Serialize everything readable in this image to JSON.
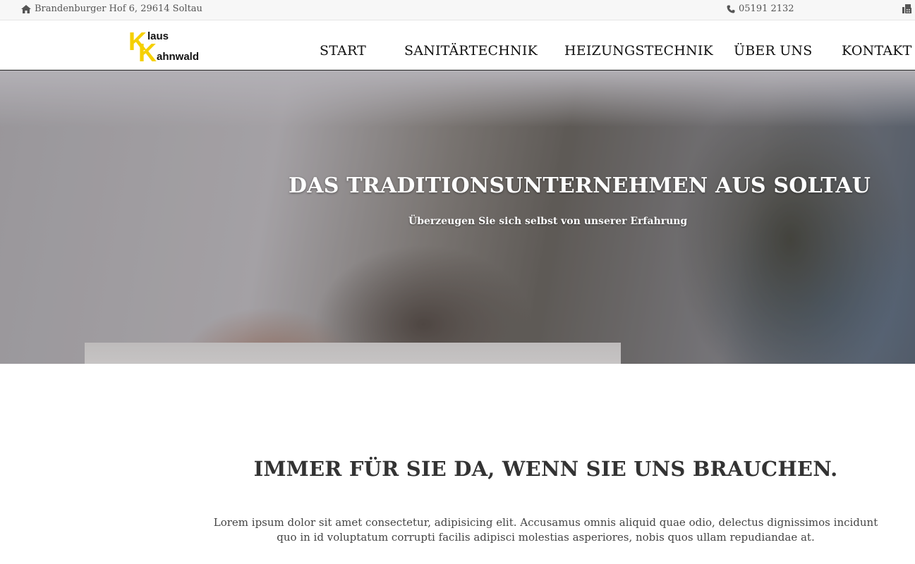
{
  "topbar": {
    "address": "Brandenburger Hof 6, 29614 Soltau",
    "phone": "05191 2132",
    "icons": {
      "address": "home-icon",
      "phone": "phone-icon",
      "fax": "fax-icon"
    }
  },
  "logo": {
    "letter_first": "K",
    "word_first": "laus",
    "letter_last": "K",
    "word_last": "ahnwald",
    "accent_color": "#f5d000"
  },
  "nav": {
    "items": [
      {
        "label": "START"
      },
      {
        "label": "SANITÄRTECHNIK"
      },
      {
        "label": "HEIZUNGSTECHNIK"
      },
      {
        "label": "ÜBER UNS"
      },
      {
        "label": "KONTAKT"
      }
    ]
  },
  "hero": {
    "title": "DAS TRADITIONSUNTERNEHMEN AUS SOLTAU",
    "subtitle": "Überzeugen Sie sich selbst von unserer Erfahrung"
  },
  "intro": {
    "heading": "IMMER FÜR SIE DA, WENN SIE UNS BRAUCHEN.",
    "text": "Lorem ipsum dolor sit amet consectetur, adipisicing elit. Accusamus omnis aliquid quae odio, delectus dignissimos incidunt quo in id voluptatum corrupti facilis adipisci molestias asperiores, nobis quos ullam repudiandae at."
  }
}
